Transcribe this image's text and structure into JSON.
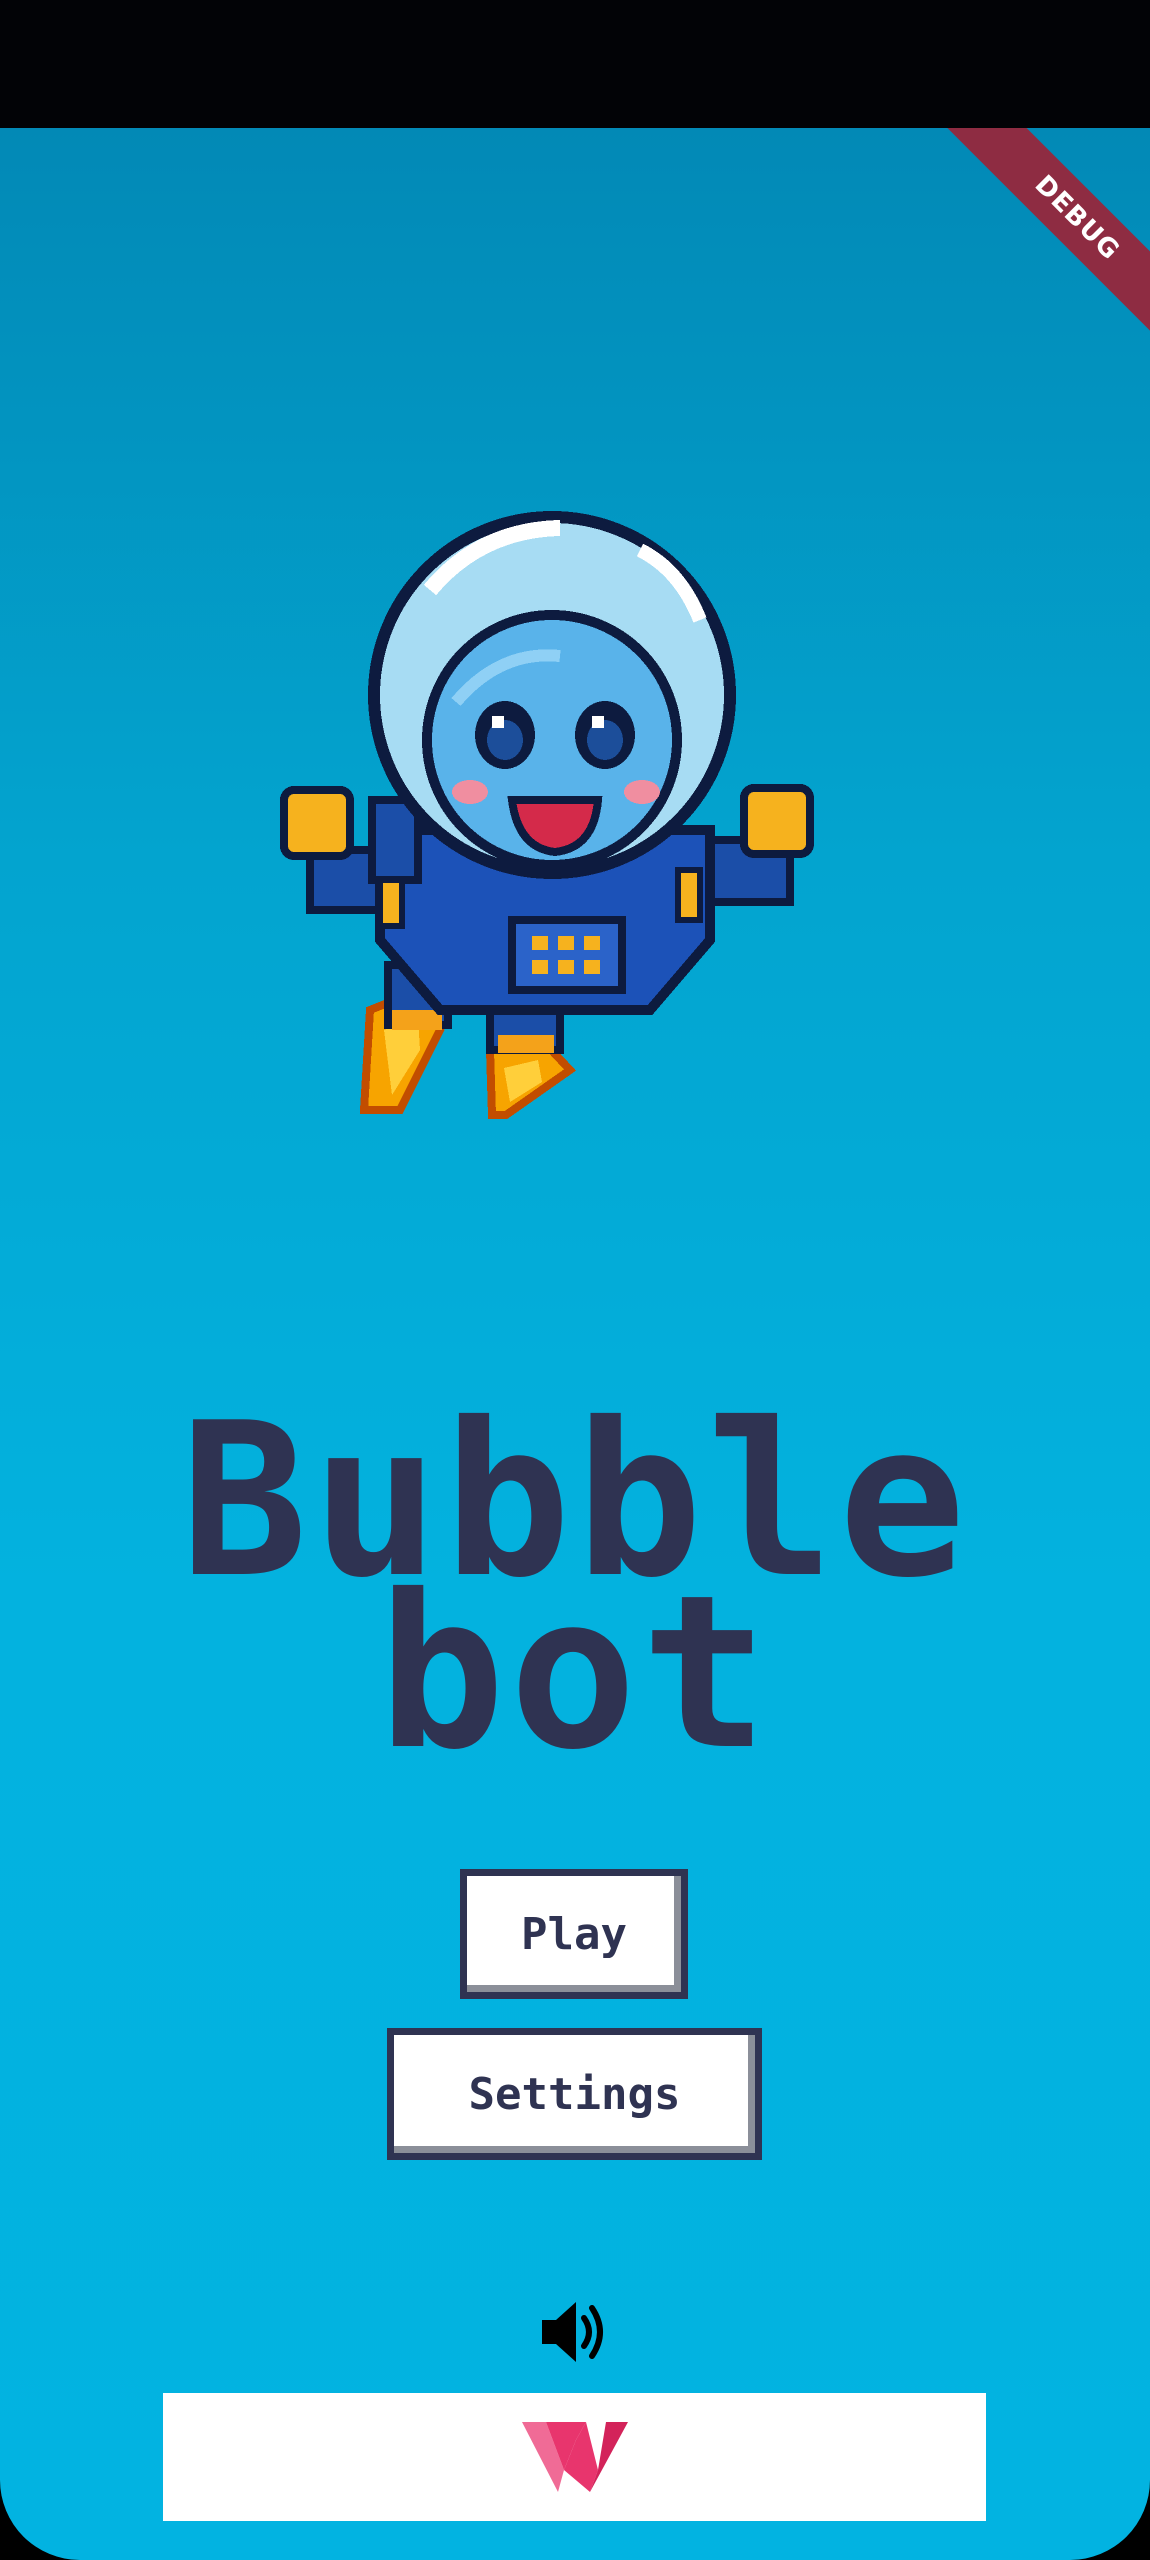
{
  "debug_banner": {
    "label": "DEBUG",
    "color": "#8e2c42"
  },
  "title": {
    "line1": "Bubble",
    "line2": "bot"
  },
  "menu": {
    "play_label": "Play",
    "settings_label": "Settings"
  },
  "sound": {
    "icon": "speaker-volume-icon"
  },
  "ad_banner": {
    "icon": "w-logo-icon",
    "logo_color": "#e8356d"
  },
  "colors": {
    "background_top": "#0289b6",
    "background_bottom": "#02b3e1",
    "text": "#2f3352",
    "button_face": "#ffffff"
  }
}
